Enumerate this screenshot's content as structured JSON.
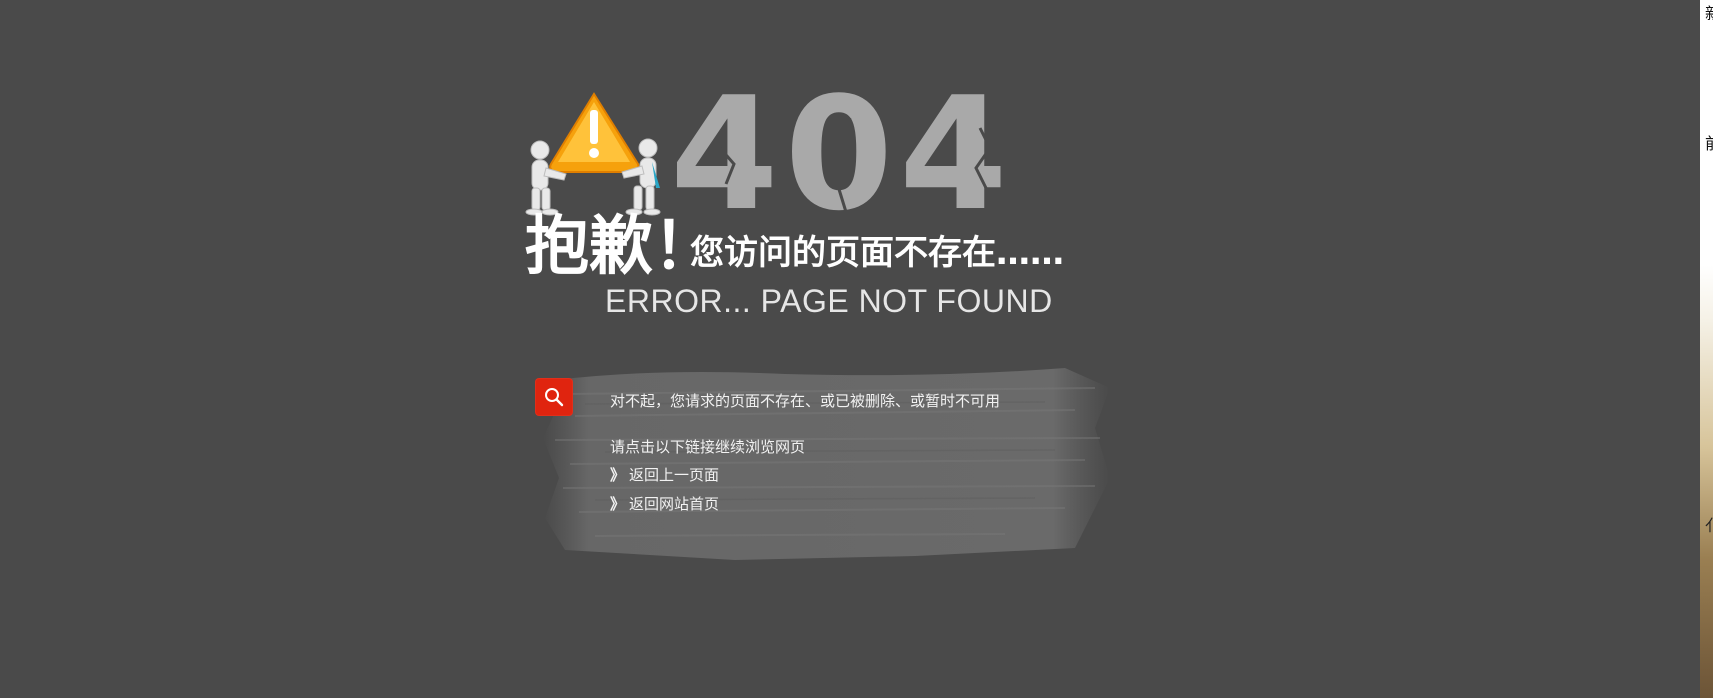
{
  "error": {
    "code": "404",
    "title": "抱歉！",
    "subtitle": "您访问的页面不存在……",
    "english": "ERROR... PAGE NOT FOUND"
  },
  "message": {
    "text": "对不起，您请求的页面不存在、或已被删除、或暂时不可用",
    "prompt": "请点击以下链接继续浏览网页",
    "links": [
      {
        "arrow": "》",
        "label": "返回上一页面"
      },
      {
        "arrow": "》",
        "label": "返回网站首页"
      }
    ]
  },
  "edge_window": {
    "chars": [
      "新",
      "前",
      "亻"
    ]
  },
  "icons": {
    "warning": "warning-triangle-icon",
    "search": "search-icon"
  },
  "colors": {
    "background": "#4a4a4a",
    "digits": "#a9a9a9",
    "badge": "#e0240f",
    "warning": "#f6a10c"
  }
}
